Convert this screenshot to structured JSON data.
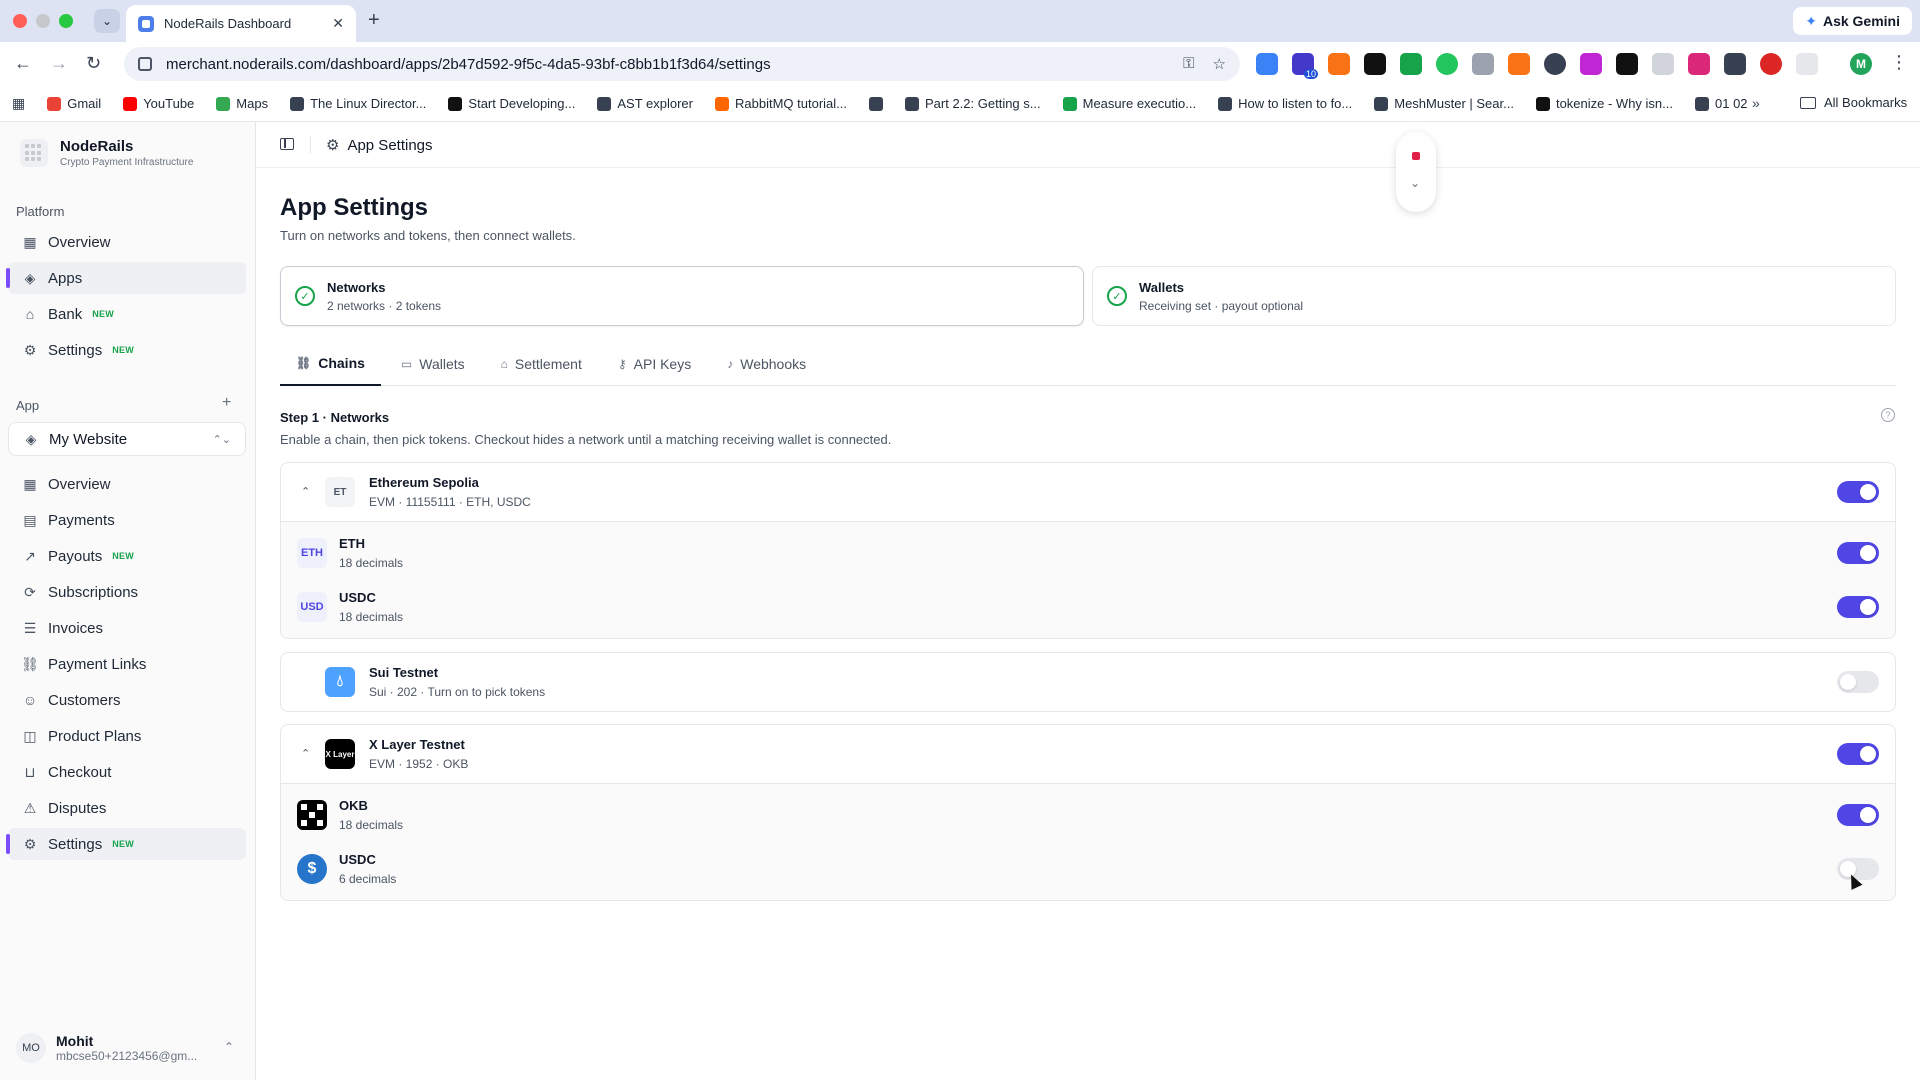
{
  "browser": {
    "tab_title": "NodeRails Dashboard",
    "url": "merchant.noderails.com/dashboard/apps/2b47d592-9f5c-4da5-93bf-c8bb1b1f3d64/settings",
    "ask_gemini": "Ask Gemini",
    "profile_initial": "M",
    "extension_badge": "10",
    "bookmarks": [
      {
        "label": "Gmail",
        "color": "#ea4335"
      },
      {
        "label": "YouTube",
        "color": "#ff0000"
      },
      {
        "label": "Maps",
        "color": "#34a853"
      },
      {
        "label": "The Linux Director...",
        "color": "#374151"
      },
      {
        "label": "Start Developing...",
        "color": "#111111"
      },
      {
        "label": "AST explorer",
        "color": "#374151"
      },
      {
        "label": "RabbitMQ tutorial...",
        "color": "#ff6600"
      },
      {
        "label": "",
        "color": "#374151"
      },
      {
        "label": "Part 2.2: Getting s...",
        "color": "#374151"
      },
      {
        "label": "Measure executio...",
        "color": "#16a34a"
      },
      {
        "label": "How to listen to fo...",
        "color": "#374151"
      },
      {
        "label": "MeshMuster | Sear...",
        "color": "#374151"
      },
      {
        "label": "tokenize - Why isn...",
        "color": "#111111"
      },
      {
        "label": "01 02",
        "color": "#374151"
      }
    ],
    "all_bookmarks": "All Bookmarks"
  },
  "sidebar": {
    "brand_name": "NodeRails",
    "brand_sub": "Crypto Payment Infrastructure",
    "platform_label": "Platform",
    "platform_items": [
      {
        "label": "Overview",
        "badge": ""
      },
      {
        "label": "Apps",
        "badge": ""
      },
      {
        "label": "Bank",
        "badge": "NEW"
      },
      {
        "label": "Settings",
        "badge": "NEW"
      }
    ],
    "app_label": "App",
    "app_select": "My Website",
    "app_items": [
      {
        "label": "Overview",
        "badge": ""
      },
      {
        "label": "Payments",
        "badge": ""
      },
      {
        "label": "Payouts",
        "badge": "NEW"
      },
      {
        "label": "Subscriptions",
        "badge": ""
      },
      {
        "label": "Invoices",
        "badge": ""
      },
      {
        "label": "Payment Links",
        "badge": ""
      },
      {
        "label": "Customers",
        "badge": ""
      },
      {
        "label": "Product Plans",
        "badge": ""
      },
      {
        "label": "Checkout",
        "badge": ""
      },
      {
        "label": "Disputes",
        "badge": ""
      },
      {
        "label": "Settings",
        "badge": "NEW"
      }
    ],
    "user": {
      "initials": "MO",
      "name": "Mohit",
      "email": "mbcse50+2123456@gm..."
    }
  },
  "topbar": {
    "title": "App Settings"
  },
  "page": {
    "title": "App Settings",
    "subtitle": "Turn on networks and tokens, then connect wallets."
  },
  "status_cards": [
    {
      "title": "Networks",
      "sub": "2 networks · 2 tokens"
    },
    {
      "title": "Wallets",
      "sub": "Receiving set · payout optional"
    }
  ],
  "tabs": [
    {
      "label": "Chains",
      "icon": "link-icon"
    },
    {
      "label": "Wallets",
      "icon": "wallet-icon"
    },
    {
      "label": "Settlement",
      "icon": "bank-icon"
    },
    {
      "label": "API Keys",
      "icon": "key-icon"
    },
    {
      "label": "Webhooks",
      "icon": "bell-icon"
    }
  ],
  "step": {
    "title": "Step 1 · Networks",
    "subtitle": "Enable a chain, then pick tokens. Checkout hides a network until a matching receiving wallet is connected."
  },
  "networks": [
    {
      "name": "Ethereum Sepolia",
      "meta": "EVM · 11155111 · ETH, USDC",
      "logo_text": "ET",
      "enabled": true,
      "tokens": [
        {
          "symbol": "ETH",
          "logo_text": "ETH",
          "decimals": "18 decimals",
          "enabled": true
        },
        {
          "symbol": "USDC",
          "logo_text": "USD",
          "decimals": "18 decimals",
          "enabled": true
        }
      ]
    },
    {
      "name": "Sui Testnet",
      "meta": "Sui · 202 · Turn on to pick tokens",
      "logo_text": "",
      "enabled": false,
      "tokens": []
    },
    {
      "name": "X Layer Testnet",
      "meta": "EVM · 1952 · OKB",
      "logo_text": "X Layer",
      "enabled": true,
      "tokens": [
        {
          "symbol": "OKB",
          "logo_text": "",
          "decimals": "18 decimals",
          "enabled": true
        },
        {
          "symbol": "USDC",
          "logo_text": "$",
          "decimals": "6 decimals",
          "enabled": false
        }
      ]
    }
  ],
  "colors": {
    "accent": "#4f46e5",
    "active_marker": "#7c4dff",
    "new_badge": "#16a34a",
    "check": "#16a34a"
  }
}
